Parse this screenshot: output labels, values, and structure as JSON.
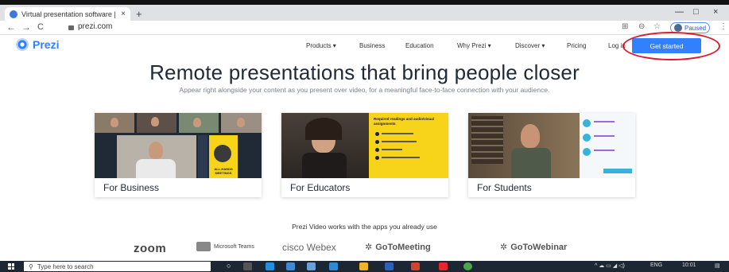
{
  "browser": {
    "tab_title": "Virtual presentation software | C",
    "tab_close": "×",
    "new_tab": "+",
    "url": "prezi.com",
    "profile_status": "Paused",
    "back": "←",
    "forward": "→",
    "reload": "C",
    "window_minimize": "—",
    "window_restore": "□",
    "window_close": "×"
  },
  "prezi_nav": {
    "logo_text": "Prezi",
    "links": [
      "Products ▾",
      "Business",
      "Education",
      "Why Prezi ▾",
      "Discover ▾",
      "Pricing",
      "Log in"
    ],
    "cta": "Get started"
  },
  "hero": {
    "headline": "Remote presentations that bring people closer",
    "subheadline": "Appear right alongside your content as you present over video, for a meaningful face-to-face connection with your audience."
  },
  "cards": [
    {
      "label": "For Business",
      "slide_text": "ALL-HANDS MEETINGS"
    },
    {
      "label": "For Educators",
      "slide_text": "Required readings and audio/visual assignments"
    },
    {
      "label": "For Students",
      "slide_text": ""
    }
  ],
  "apps": {
    "caption": "Prezi Video works with the apps you already use",
    "logos": [
      "zoom",
      "Microsoft Teams",
      "cisco Webex",
      "GoToMeeting",
      "GoToWebinar"
    ]
  },
  "taskbar": {
    "search_placeholder": "Type here to search",
    "time": "10:01",
    "lang": "ENG"
  },
  "colors": {
    "accent": "#3181ff",
    "annotation": "#e0182d",
    "taskbar": "#1d2733",
    "slide_yellow": "#f7d31a"
  }
}
